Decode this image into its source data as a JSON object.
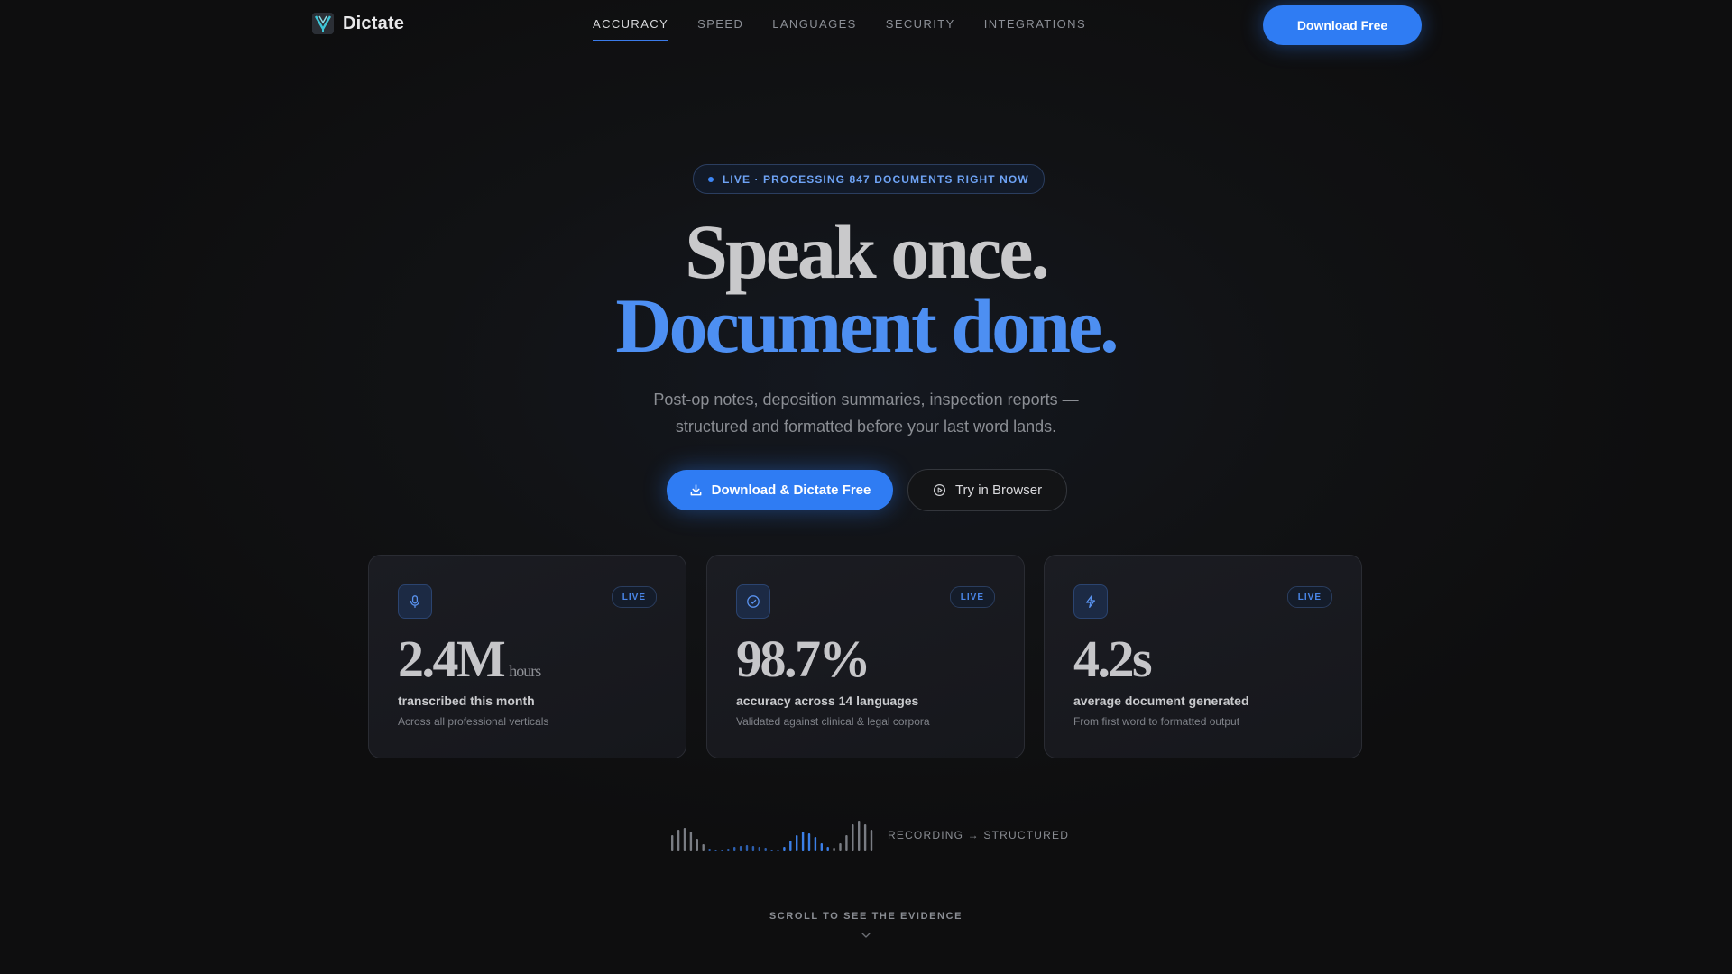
{
  "brand": {
    "name": "Dictate"
  },
  "nav": {
    "links": [
      "ACCURACY",
      "SPEED",
      "LANGUAGES",
      "SECURITY",
      "INTEGRATIONS"
    ],
    "active_index": 0,
    "cta": "Download Free"
  },
  "hero": {
    "badge": "LIVE · PROCESSING 847 DOCUMENTS RIGHT NOW",
    "title_line1": "Speak once.",
    "title_line2": "Document done.",
    "subtitle_line1": "Post-op notes, deposition summaries, inspection reports —",
    "subtitle_line2": "structured and formatted before your last word lands.",
    "primary_cta": "Download & Dictate Free",
    "secondary_cta": "Try in Browser"
  },
  "stats": [
    {
      "icon": "microphone-icon",
      "badge": "LIVE",
      "value": "2.4M",
      "unit": "hours",
      "label": "transcribed this month",
      "desc": "Across all professional verticals"
    },
    {
      "icon": "check-circle-icon",
      "badge": "LIVE",
      "value": "98.7%",
      "unit": "",
      "label": "accuracy across 14 languages",
      "desc": "Validated against clinical & legal corpora"
    },
    {
      "icon": "lightning-icon",
      "badge": "LIVE",
      "value": "4.2s",
      "unit": "",
      "label": "average document generated",
      "desc": "From first word to formatted output"
    }
  ],
  "waveform": {
    "label": "RECORDING → STRUCTURED"
  },
  "scroll": {
    "label": "SCROLL TO SEE THE EVIDENCE"
  },
  "colors": {
    "accent": "#2f7cf3",
    "accent_text": "#4d8ff2",
    "background": "#0f0f10"
  }
}
